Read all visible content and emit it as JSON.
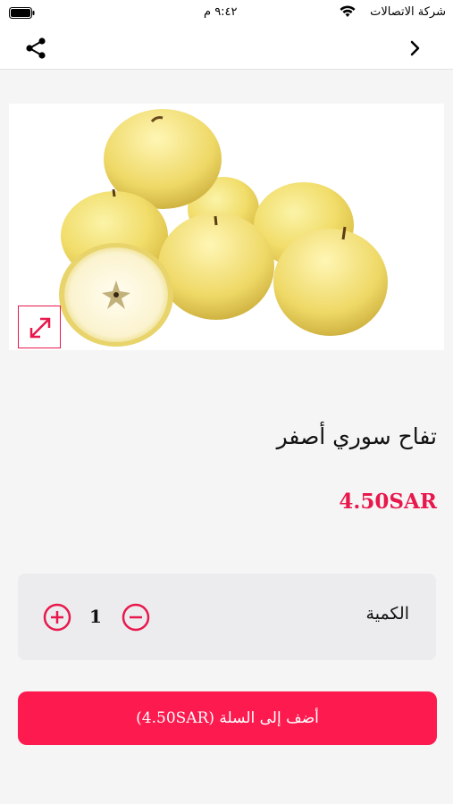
{
  "status_bar": {
    "carrier": "شركة الاتصالات",
    "time": "٩:٤٢ م"
  },
  "nav": {
    "share_icon": "share-icon",
    "back_icon": "chevron-right-icon"
  },
  "product": {
    "image_alt": "apples",
    "title": "تفاح سوري أصفر",
    "price": "4.50SAR"
  },
  "quantity": {
    "label": "الكمية",
    "value": "1"
  },
  "cart_button": {
    "label": "أضف إلى السلة (4.50SAR)"
  },
  "colors": {
    "accent": "#e8184c",
    "button": "#fc1a4f",
    "background": "#f5f5f6",
    "quantity_box": "#ececee"
  }
}
